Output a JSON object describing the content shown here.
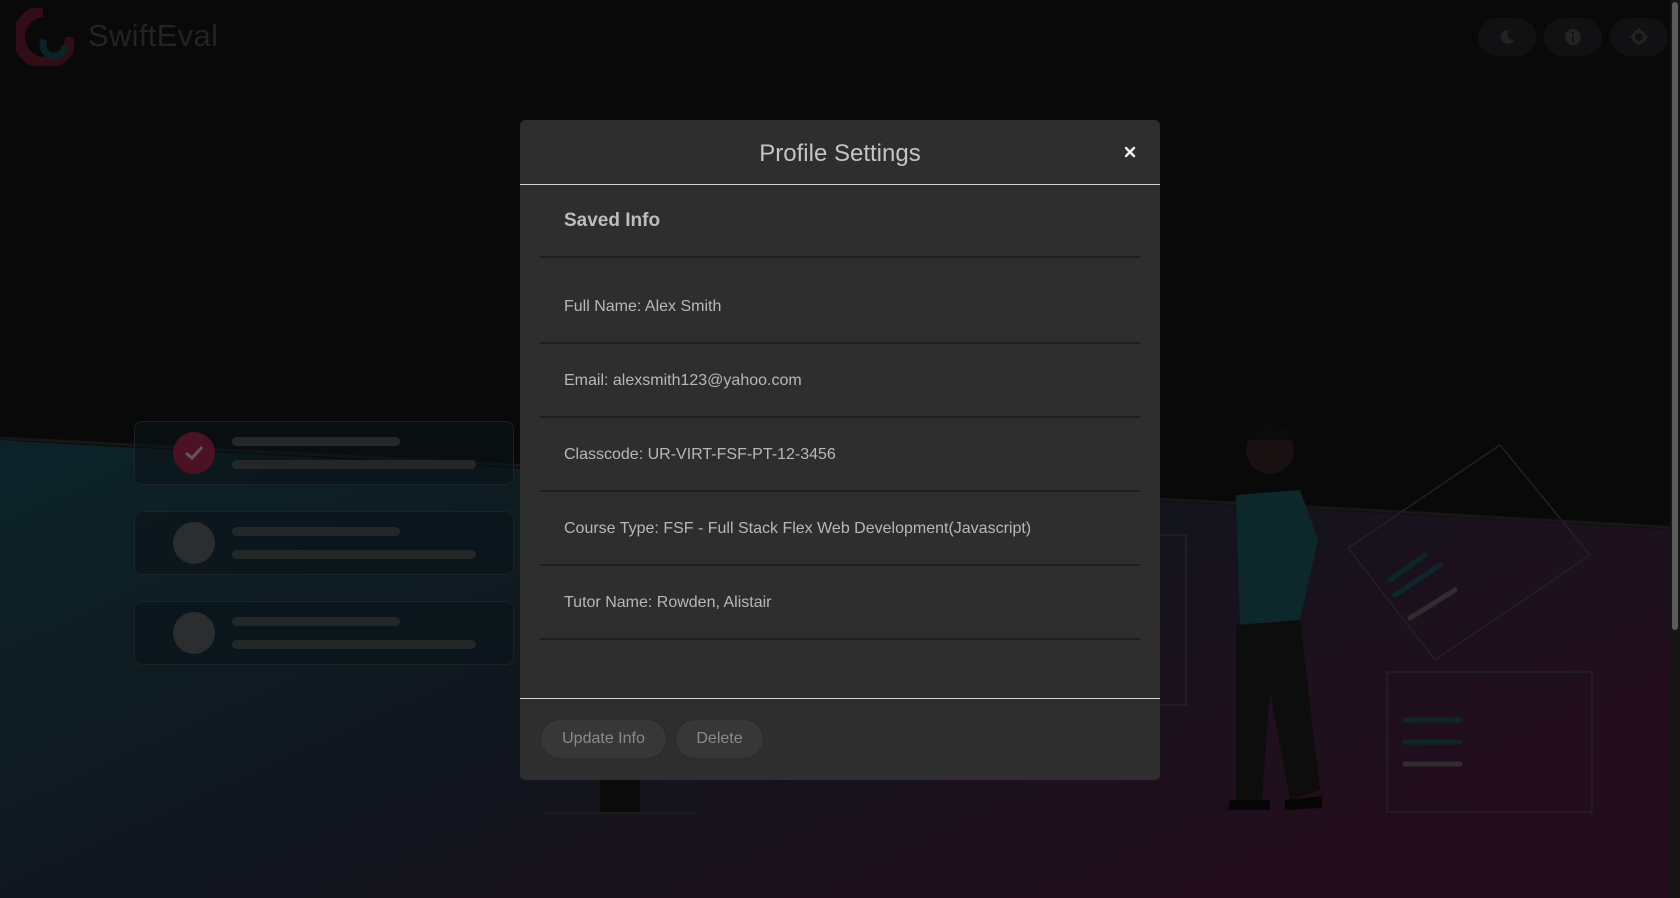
{
  "app": {
    "name": "SwiftEval"
  },
  "header": {
    "buttons": [
      {
        "icon": "moon-icon",
        "label": ""
      },
      {
        "icon": "info-icon",
        "label": ""
      },
      {
        "icon": "gear-icon",
        "label": ""
      }
    ]
  },
  "modal": {
    "title": "Profile Settings",
    "close_label": "×",
    "section_heading": "Saved Info",
    "fields": [
      {
        "label": "Full Name: Alex Smith"
      },
      {
        "label": "Email: alexsmith123@yahoo.com"
      },
      {
        "label": "Classcode: UR-VIRT-FSF-PT-12-3456"
      },
      {
        "label": "Course Type: FSF - Full Stack Flex Web Development(Javascript)"
      },
      {
        "label": "Tutor Name: Rowden, Alistair"
      }
    ],
    "buttons": {
      "update": "Update Info",
      "delete": "Delete"
    }
  },
  "colors": {
    "modal_bg": "#2e2e2e",
    "accent_brand": "#5a1429",
    "teal_wave": "#0f2a30"
  }
}
